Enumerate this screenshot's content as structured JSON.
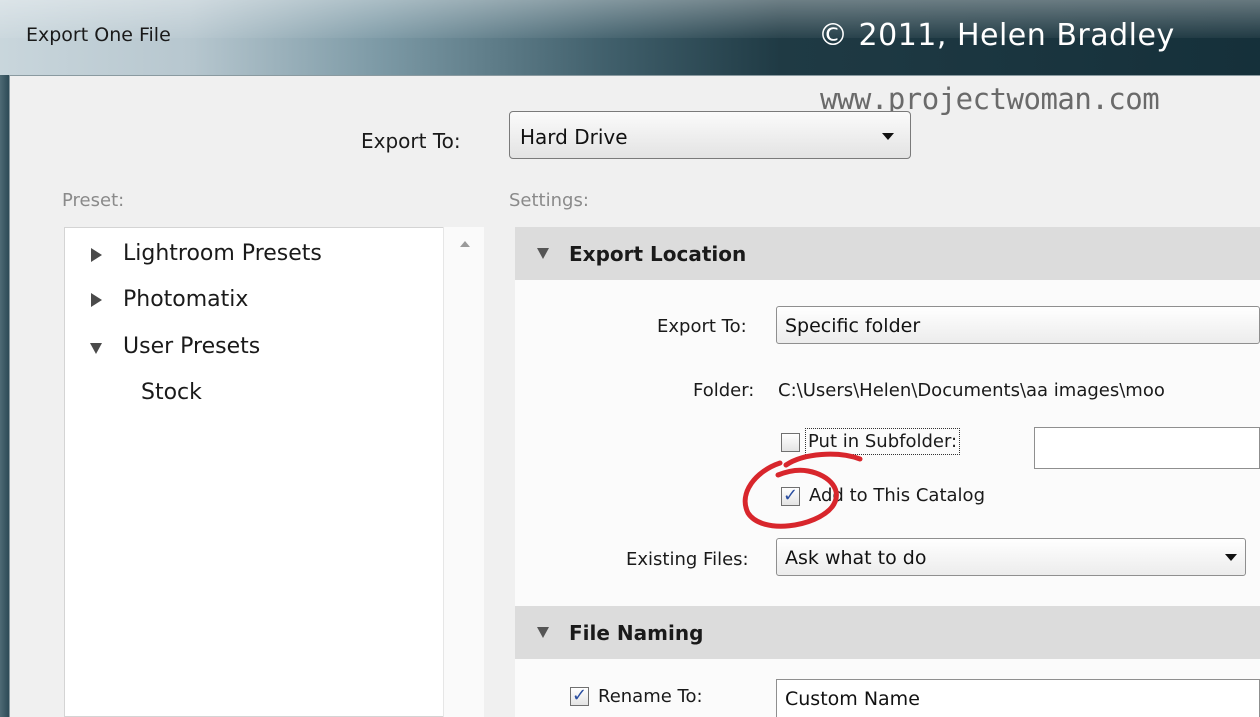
{
  "window": {
    "title": "Export One File",
    "copyright": "© 2011, Helen Bradley",
    "watermark": "www.projectwoman.com"
  },
  "export_to": {
    "label": "Export To:",
    "value": "Hard Drive"
  },
  "preset": {
    "label": "Preset:",
    "items": [
      {
        "label": "Lightroom Presets",
        "expanded": false
      },
      {
        "label": "Photomatix",
        "expanded": false
      },
      {
        "label": "User Presets",
        "expanded": true
      },
      {
        "label": "Stock",
        "child": true
      }
    ]
  },
  "settings": {
    "label": "Settings:",
    "export_location": {
      "title": "Export Location",
      "export_to_label": "Export To:",
      "export_to_value": "Specific folder",
      "folder_label": "Folder:",
      "folder_value": "C:\\Users\\Helen\\Documents\\aa images\\moo",
      "subfolder_label": "Put in Subfolder:",
      "subfolder_checked": false,
      "subfolder_value": "",
      "add_catalog_label": "Add to This Catalog",
      "add_catalog_checked": true,
      "existing_files_label": "Existing Files:",
      "existing_files_value": "Ask what to do"
    },
    "file_naming": {
      "title": "File Naming",
      "rename_label": "Rename To:",
      "rename_checked": true,
      "rename_value": "Custom Name"
    }
  },
  "annotation_color": "#d8262c",
  "checkmark_color": "#2a4ea0"
}
